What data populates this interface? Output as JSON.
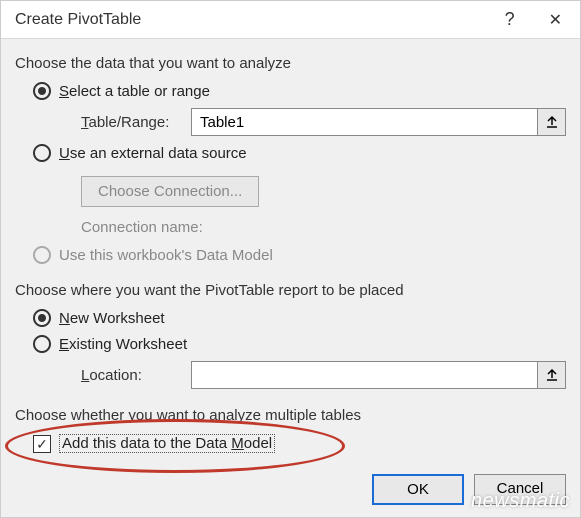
{
  "titlebar": {
    "title": "Create PivotTable",
    "help": "?",
    "close": "✕"
  },
  "section1": {
    "label": "Choose the data that you want to analyze",
    "radio_select_prefix": "S",
    "radio_select_text": "elect a table or range",
    "table_range_prefix": "T",
    "table_range_label": "able/Range:",
    "table_range_value": "Table1",
    "radio_external_prefix": "U",
    "radio_external_text": "se an external data source",
    "choose_connection": "Choose Connection...",
    "connection_name": "Connection name:",
    "radio_datamodel_text": "Use this workbook's Data Model"
  },
  "section2": {
    "label": "Choose where you want the PivotTable report to be placed",
    "radio_new_prefix": "N",
    "radio_new_text": "ew Worksheet",
    "radio_existing_prefix": "E",
    "radio_existing_text": "xisting Worksheet",
    "location_prefix": "L",
    "location_label": "ocation:",
    "location_value": ""
  },
  "section3": {
    "label": "Choose whether you want to analyze multiple tables",
    "checkbox_text_pre": "Add this data to the Data ",
    "checkbox_text_u": "M",
    "checkbox_text_post": "odel"
  },
  "buttons": {
    "ok": "OK",
    "cancel": "Cancel"
  },
  "watermark": "newsmatic"
}
